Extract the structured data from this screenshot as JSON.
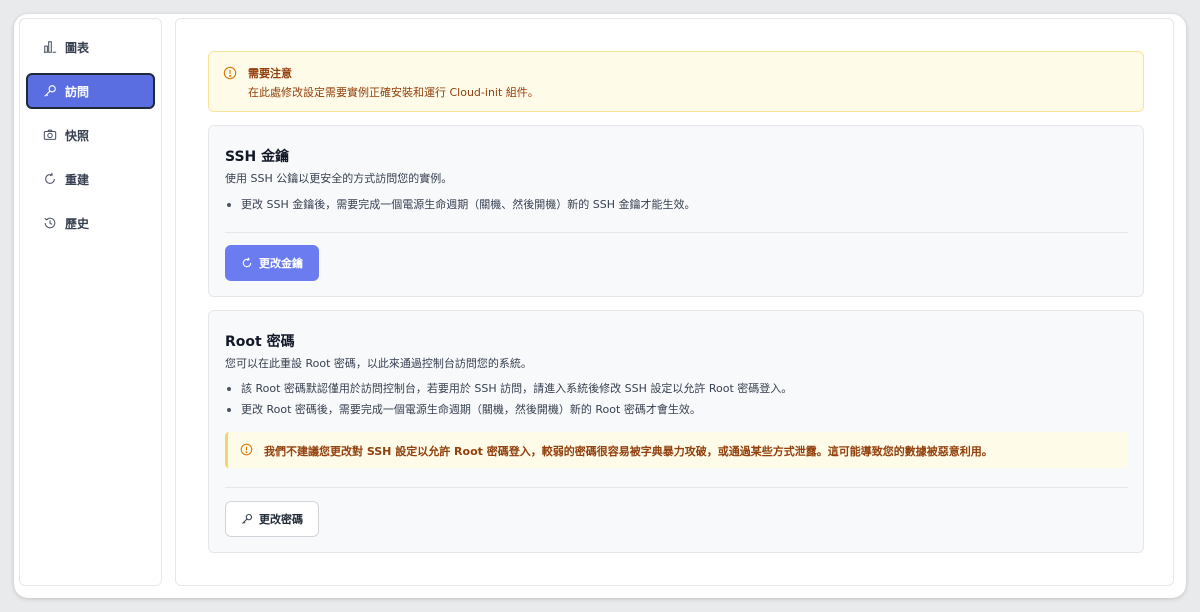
{
  "sidebar": {
    "items": [
      {
        "label": "圖表",
        "icon": "chart-icon"
      },
      {
        "label": "訪問",
        "icon": "key-icon",
        "active": true
      },
      {
        "label": "快照",
        "icon": "camera-icon"
      },
      {
        "label": "重建",
        "icon": "refresh-icon"
      },
      {
        "label": "歷史",
        "icon": "history-icon"
      }
    ]
  },
  "notice": {
    "title": "需要注意",
    "text": "在此處修改設定需要實例正確安裝和運行 Cloud-init 組件。"
  },
  "ssh": {
    "title": "SSH 金鑰",
    "description": "使用 SSH 公鑰以更安全的方式訪問您的實例。",
    "bullets": [
      "更改 SSH 金鑰後，需要完成一個電源生命週期（關機、然後開機）新的 SSH 金鑰才能生效。"
    ],
    "button_label": "更改金鑰"
  },
  "root": {
    "title": "Root 密碼",
    "description": "您可以在此重設 Root 密碼，以此來通過控制台訪問您的系統。",
    "bullets": [
      "該 Root 密碼默認僅用於訪問控制台，若要用於 SSH 訪問，請進入系統後修改 SSH 設定以允許 Root 密碼登入。",
      "更改 Root 密碼後，需要完成一個電源生命週期（關機，然後開機）新的 Root 密碼才會生效。"
    ],
    "warning": "我們不建議您更改對 SSH 設定以允許 Root 密碼登入，較弱的密碼很容易被字典暴力攻破，或通過某些方式泄露。這可能導致您的數據被惡意利用。",
    "button_label": "更改密碼"
  },
  "colors": {
    "accent": "#6b7cf0",
    "active_nav": "#5b6ee1",
    "warning_bg": "#fefbe8",
    "warning_text": "#92400e"
  }
}
